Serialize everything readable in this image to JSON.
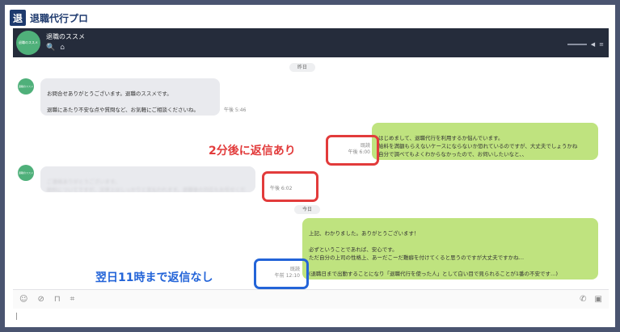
{
  "brand": {
    "logo_char": "退",
    "name": "退職代行プロ"
  },
  "header": {
    "avatar_text": "退職のススメ",
    "title": "退職のススメ",
    "search_icon": "🔍",
    "home_icon": "⌂",
    "volume_icon": "◀",
    "menu_icon": "≡"
  },
  "messages": {
    "date_yesterday": "昨日",
    "date_today": "今日",
    "avatar_text": "退職のススメ",
    "m1_text": "お問合せありがとうございます。退職のススメです。\n\n退職にあたり不安な点や質問など、お気軽にご相談くださいね。",
    "m1_time": "午後 5:46",
    "m2_text": "はじめまして、退職代行を利用するか悩んでいます。\n給料を満額もらえないケースにならないか恐れているのですが、大丈夫でしょうかね\n自分で調べてもよくわからなかったので、お伺いしたいなと、、",
    "m2_read": "既読",
    "m2_time": "午後 6:00",
    "m3_text": "ご連絡ありがとうございます。\n給料についてですが、法律上はしっかりと支払われます。退職後の対応もお任せください。",
    "m3_time": "午後 6:02",
    "m4_text": "上記、わかりました。ありがとうございます！\n\n必ずということであれば、安心です。\nただ自分の上司の性格上、あーだこーだ難癖を付けてくると思うのですが大丈夫ですかね…\n\n(退職日まで出勤することになり「退職代行を使った人」として白い目で見られることが1番の不安です…)",
    "m4_read": "既読",
    "m4_time": "午前 12:10"
  },
  "annotations": {
    "red_text": "2分後に返信あり",
    "blue_text": "翌日11時まで返信なし"
  },
  "toolbar": {
    "emoji_icon": "☺",
    "attach_icon": "⊘",
    "bookmark_icon": "⊓",
    "crop_icon": "⌗",
    "call_icon": "✆",
    "screen_icon": "▣"
  }
}
